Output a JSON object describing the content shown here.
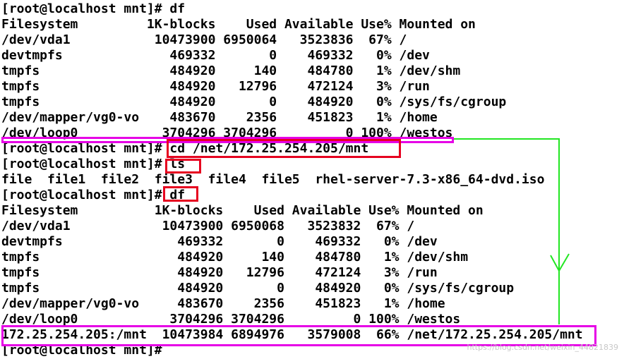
{
  "terminal": {
    "lines": [
      "[root@localhost mnt]# df",
      "Filesystem         1K-blocks    Used Available Use% Mounted on",
      "/dev/vda1           10473900 6950064   3523836  67% /",
      "devtmpfs              469332       0    469332   0% /dev",
      "tmpfs                 484920     140    484780   1% /dev/shm",
      "tmpfs                 484920   12796    472124   3% /run",
      "tmpfs                 484920       0    484920   0% /sys/fs/cgroup",
      "/dev/mapper/vg0-vo    483670    2356    451823   1% /home",
      "/dev/loop0           3704296 3704296         0 100% /westos",
      "[root@localhost mnt]# cd /net/172.25.254.205/mnt",
      "[root@localhost mnt]# ls",
      "file  file1  file2  file3  file4  file5  rhel-server-7.3-x86_64-dvd.iso",
      "[root@localhost mnt]# df",
      "Filesystem          1K-blocks    Used Available Use% Mounted on",
      "/dev/vda1            10473900 6950068   3523832  67% /",
      "devtmpfs               469332       0    469332   0% /dev",
      "tmpfs                  484920     140    484780   1% /dev/shm",
      "tmpfs                  484920   12796    472124   3% /run",
      "tmpfs                  484920       0    484920   0% /sys/fs/cgroup",
      "/dev/mapper/vg0-vo     483670    2356    451823   1% /home",
      "/dev/loop0            3704296 3704296         0 100% /westos",
      "172.25.254.205:/mnt  10473984 6894976   3579008  66% /net/172.25.254.205/mnt",
      "[root@localhost mnt]#"
    ]
  },
  "annotations": {
    "red": "#e6001f",
    "magenta": "#e600e6",
    "green": "#22e622"
  },
  "watermark": "https://blog.csdn.net/weixin_44821839"
}
